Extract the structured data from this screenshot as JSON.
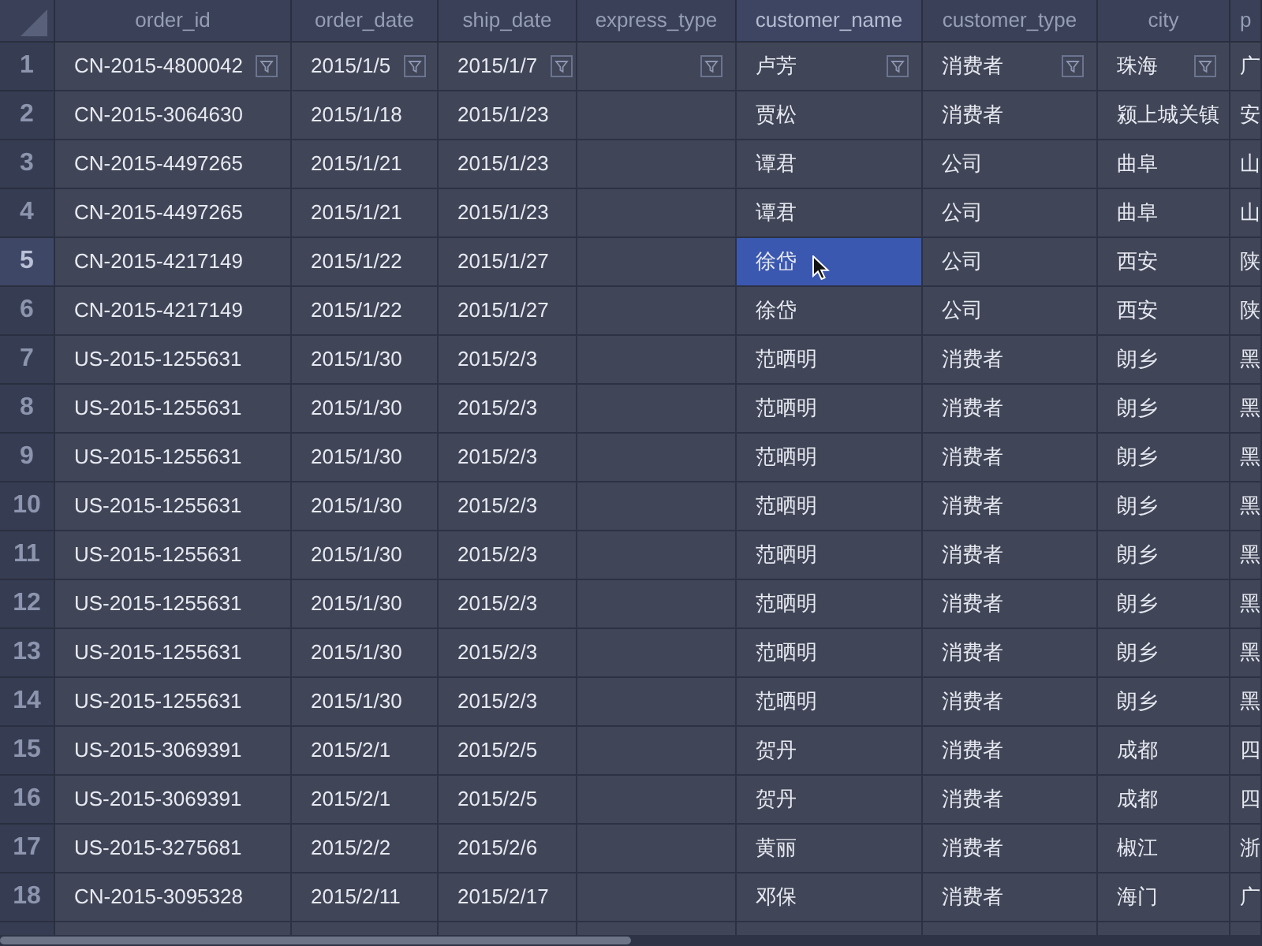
{
  "columns": [
    {
      "label": "order_id",
      "selected": false
    },
    {
      "label": "order_date",
      "selected": false
    },
    {
      "label": "ship_date",
      "selected": false
    },
    {
      "label": "express_type",
      "selected": false
    },
    {
      "label": "customer_name",
      "selected": true
    },
    {
      "label": "customer_type",
      "selected": false
    },
    {
      "label": "city",
      "selected": false
    },
    {
      "label": "p",
      "selected": false
    }
  ],
  "rows": [
    {
      "number": "1",
      "selected": false,
      "filter_buttons": true,
      "cells": [
        "CN-2015-4800042",
        "2015/1/5",
        "2015/1/7",
        "",
        "卢芳",
        "消费者",
        "珠海",
        "广"
      ]
    },
    {
      "number": "2",
      "selected": false,
      "filter_buttons": false,
      "cells": [
        "CN-2015-3064630",
        "2015/1/18",
        "2015/1/23",
        "",
        "贾松",
        "消费者",
        "颍上城关镇",
        "安"
      ]
    },
    {
      "number": "3",
      "selected": false,
      "filter_buttons": false,
      "cells": [
        "CN-2015-4497265",
        "2015/1/21",
        "2015/1/23",
        "",
        "谭君",
        "公司",
        "曲阜",
        "山"
      ]
    },
    {
      "number": "4",
      "selected": false,
      "filter_buttons": false,
      "cells": [
        "CN-2015-4497265",
        "2015/1/21",
        "2015/1/23",
        "",
        "谭君",
        "公司",
        "曲阜",
        "山"
      ]
    },
    {
      "number": "5",
      "selected": true,
      "filter_buttons": false,
      "cells": [
        "CN-2015-4217149",
        "2015/1/22",
        "2015/1/27",
        "",
        "徐岱",
        "公司",
        "西安",
        "陕"
      ]
    },
    {
      "number": "6",
      "selected": false,
      "filter_buttons": false,
      "cells": [
        "CN-2015-4217149",
        "2015/1/22",
        "2015/1/27",
        "",
        "徐岱",
        "公司",
        "西安",
        "陕"
      ]
    },
    {
      "number": "7",
      "selected": false,
      "filter_buttons": false,
      "cells": [
        "US-2015-1255631",
        "2015/1/30",
        "2015/2/3",
        "",
        "范晒明",
        "消费者",
        "朗乡",
        "黑"
      ]
    },
    {
      "number": "8",
      "selected": false,
      "filter_buttons": false,
      "cells": [
        "US-2015-1255631",
        "2015/1/30",
        "2015/2/3",
        "",
        "范晒明",
        "消费者",
        "朗乡",
        "黑"
      ]
    },
    {
      "number": "9",
      "selected": false,
      "filter_buttons": false,
      "cells": [
        "US-2015-1255631",
        "2015/1/30",
        "2015/2/3",
        "",
        "范晒明",
        "消费者",
        "朗乡",
        "黑"
      ]
    },
    {
      "number": "10",
      "selected": false,
      "filter_buttons": false,
      "cells": [
        "US-2015-1255631",
        "2015/1/30",
        "2015/2/3",
        "",
        "范晒明",
        "消费者",
        "朗乡",
        "黑"
      ]
    },
    {
      "number": "11",
      "selected": false,
      "filter_buttons": false,
      "cells": [
        "US-2015-1255631",
        "2015/1/30",
        "2015/2/3",
        "",
        "范晒明",
        "消费者",
        "朗乡",
        "黑"
      ]
    },
    {
      "number": "12",
      "selected": false,
      "filter_buttons": false,
      "cells": [
        "US-2015-1255631",
        "2015/1/30",
        "2015/2/3",
        "",
        "范晒明",
        "消费者",
        "朗乡",
        "黑"
      ]
    },
    {
      "number": "13",
      "selected": false,
      "filter_buttons": false,
      "cells": [
        "US-2015-1255631",
        "2015/1/30",
        "2015/2/3",
        "",
        "范晒明",
        "消费者",
        "朗乡",
        "黑"
      ]
    },
    {
      "number": "14",
      "selected": false,
      "filter_buttons": false,
      "cells": [
        "US-2015-1255631",
        "2015/1/30",
        "2015/2/3",
        "",
        "范晒明",
        "消费者",
        "朗乡",
        "黑"
      ]
    },
    {
      "number": "15",
      "selected": false,
      "filter_buttons": false,
      "cells": [
        "US-2015-3069391",
        "2015/2/1",
        "2015/2/5",
        "",
        "贺丹",
        "消费者",
        "成都",
        "四"
      ]
    },
    {
      "number": "16",
      "selected": false,
      "filter_buttons": false,
      "cells": [
        "US-2015-3069391",
        "2015/2/1",
        "2015/2/5",
        "",
        "贺丹",
        "消费者",
        "成都",
        "四"
      ]
    },
    {
      "number": "17",
      "selected": false,
      "filter_buttons": false,
      "cells": [
        "US-2015-3275681",
        "2015/2/2",
        "2015/2/6",
        "",
        "黄丽",
        "消费者",
        "椒江",
        "浙"
      ]
    },
    {
      "number": "18",
      "selected": false,
      "filter_buttons": false,
      "cells": [
        "CN-2015-3095328",
        "2015/2/11",
        "2015/2/17",
        "",
        "邓保",
        "消费者",
        "海门",
        "广"
      ]
    }
  ]
}
